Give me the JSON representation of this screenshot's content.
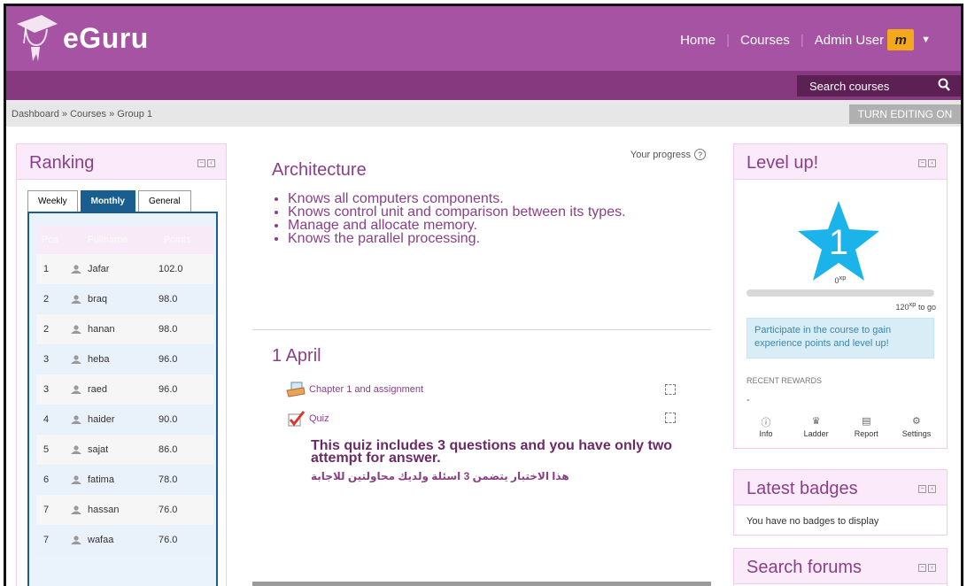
{
  "brand": {
    "name": "eGuru"
  },
  "nav": {
    "home": "Home",
    "courses": "Courses",
    "user": "Admin User",
    "avatar_text": "m",
    "search_label": "Search courses"
  },
  "breadcrumb": {
    "dashboard": "Dashboard",
    "sep": "»",
    "courses": "Courses",
    "group": "Group 1"
  },
  "editing_button": "TURN EDITING ON",
  "colors": {
    "brand": "#a553a2",
    "subbar": "#86397f",
    "accent_blue": "#1a5d8f",
    "star": "#1ab3ea"
  },
  "ranking": {
    "title": "Ranking",
    "tabs": [
      "Weekly",
      "Monthly",
      "General"
    ],
    "active_tab": "Monthly",
    "headers": {
      "pos": "Pos",
      "name": "Fullname",
      "points": "Points"
    },
    "rows": [
      {
        "pos": "1",
        "name": "Jafar",
        "points": "102.0"
      },
      {
        "pos": "2",
        "name": "braq",
        "points": "98.0"
      },
      {
        "pos": "2",
        "name": "hanan",
        "points": "98.0"
      },
      {
        "pos": "3",
        "name": "heba",
        "points": "96.0"
      },
      {
        "pos": "3",
        "name": "raed",
        "points": "96.0"
      },
      {
        "pos": "4",
        "name": "haider",
        "points": "90.0"
      },
      {
        "pos": "5",
        "name": "sajat",
        "points": "86.0"
      },
      {
        "pos": "6",
        "name": "fatima",
        "points": "78.0"
      },
      {
        "pos": "7",
        "name": "hassan",
        "points": "76.0"
      },
      {
        "pos": "7",
        "name": "wafaa",
        "points": "76.0"
      }
    ]
  },
  "main": {
    "progress_label": "Your progress",
    "section1": {
      "title": "Architecture",
      "goals": [
        "Knows all computers components.",
        "Knows control unit and comparison between its types.",
        "Manage and allocate memory.",
        "Knows the parallel processing."
      ]
    },
    "section2": {
      "title": "1 April",
      "activities": [
        {
          "label": "Chapter 1 and assignment",
          "icon": "assignment-icon"
        },
        {
          "label": "Quiz",
          "icon": "quiz-icon"
        }
      ],
      "quiz_desc": "This quiz includes 3 questions and you have only two attempt for answer.",
      "quiz_desc_ar": "هذا الاختبار يتضمن 3 اسئلة ولديك محاولتين للاجابة"
    }
  },
  "levelup": {
    "title": "Level up!",
    "level": "1",
    "xp_now": "0",
    "xp_unit": "xp",
    "xp_to_go": "120",
    "to_go_label": "to go",
    "progress_fraction": 0,
    "info": "Participate in the course to gain experience points and level up!",
    "recent_label": "RECENT REWARDS",
    "recent_value": "-",
    "links": [
      {
        "label": "Info",
        "icon": "info-icon"
      },
      {
        "label": "Ladder",
        "icon": "trophy-icon"
      },
      {
        "label": "Report",
        "icon": "report-icon"
      },
      {
        "label": "Settings",
        "icon": "gear-icon"
      }
    ]
  },
  "badges": {
    "title": "Latest badges",
    "message": "You have no badges to display"
  },
  "forums": {
    "title": "Search forums"
  }
}
